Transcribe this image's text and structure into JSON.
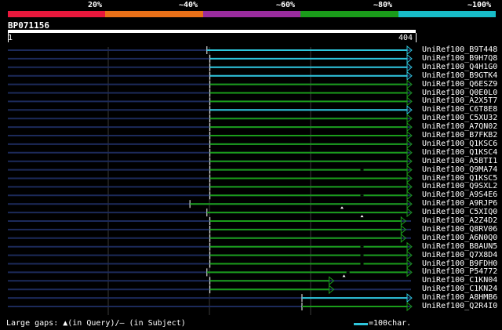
{
  "identity_scale": [
    {
      "label": "20%",
      "color": "#e8183c"
    },
    {
      "label": "~40%",
      "color": "#e87018"
    },
    {
      "label": "~60%",
      "color": "#9a2c9e"
    },
    {
      "label": "~80%",
      "color": "#1a9c1a"
    },
    {
      "label": "~100%",
      "color": "#18bcc8"
    }
  ],
  "query": {
    "name": "BP071156",
    "start": "1",
    "end": "404",
    "length": 404
  },
  "hits": [
    {
      "name": "UniRef100_B9T448",
      "qstart": 200,
      "qend": 404,
      "color": "#2ec6dc",
      "arrow": true
    },
    {
      "name": "UniRef100_B9H7Q8",
      "qstart": 203,
      "qend": 404,
      "color": "#2ec6dc",
      "arrow": true
    },
    {
      "name": "UniRef100_Q4H1G0",
      "qstart": 203,
      "qend": 404,
      "color": "#2ec6dc",
      "arrow": true
    },
    {
      "name": "UniRef100_B9GTK4",
      "qstart": 203,
      "qend": 404,
      "color": "#2ec6dc",
      "arrow": true
    },
    {
      "name": "UniRef100_Q6ESZ9",
      "qstart": 203,
      "qend": 404,
      "color": "#1a9c1a",
      "arrow": true
    },
    {
      "name": "UniRef100_Q0E0L0",
      "qstart": 203,
      "qend": 404,
      "color": "#1a9c1a",
      "arrow": true
    },
    {
      "name": "UniRef100_A2X5T7",
      "qstart": 203,
      "qend": 404,
      "color": "#1a9c1a",
      "arrow": true
    },
    {
      "name": "UniRef100_C6T8E8",
      "qstart": 203,
      "qend": 404,
      "color": "#2ec6dc",
      "arrow": true
    },
    {
      "name": "UniRef100_C5XU32",
      "qstart": 203,
      "qend": 404,
      "color": "#1a9c1a",
      "arrow": true
    },
    {
      "name": "UniRef100_A7QN02",
      "qstart": 203,
      "qend": 404,
      "color": "#1a9c1a",
      "arrow": true
    },
    {
      "name": "UniRef100_B7FKB2",
      "qstart": 203,
      "qend": 404,
      "color": "#1a9c1a",
      "arrow": true
    },
    {
      "name": "UniRef100_Q1KSC6",
      "qstart": 203,
      "qend": 404,
      "color": "#1a9c1a",
      "arrow": true
    },
    {
      "name": "UniRef100_Q1KSC4",
      "qstart": 203,
      "qend": 404,
      "color": "#1a9c1a",
      "arrow": true
    },
    {
      "name": "UniRef100_A5BTI1",
      "qstart": 203,
      "qend": 404,
      "color": "#1a9c1a",
      "arrow": true
    },
    {
      "name": "UniRef100_Q9MA74",
      "qstart": 203,
      "qend": 404,
      "color": "#1a9c1a",
      "arrow": true,
      "gap_subject": 355
    },
    {
      "name": "UniRef100_Q1KSC5",
      "qstart": 203,
      "qend": 404,
      "color": "#1a9c1a",
      "arrow": true
    },
    {
      "name": "UniRef100_Q9SXL2",
      "qstart": 203,
      "qend": 404,
      "color": "#1a9c1a",
      "arrow": true
    },
    {
      "name": "UniRef100_A9S4E6",
      "qstart": 203,
      "qend": 404,
      "color": "#1a9c1a",
      "arrow": true,
      "gap_subject": 355
    },
    {
      "name": "UniRef100_A9RJP6",
      "qstart": 183,
      "qend": 404,
      "color": "#1a9c1a",
      "arrow": true,
      "gap_query": 335
    },
    {
      "name": "UniRef100_C5XIQ0",
      "qstart": 200,
      "qend": 404,
      "color": "#1a9c1a",
      "arrow": true,
      "gap_query": 355
    },
    {
      "name": "UniRef100_A2Z4D2",
      "qstart": 203,
      "qend": 398,
      "color": "#1a9c1a",
      "arrow": true
    },
    {
      "name": "UniRef100_Q8RV06",
      "qstart": 203,
      "qend": 398,
      "color": "#1a9c1a",
      "arrow": true
    },
    {
      "name": "UniRef100_A6N0Q0",
      "qstart": 203,
      "qend": 398,
      "color": "#1a9c1a",
      "arrow": true
    },
    {
      "name": "UniRef100_B8AUN5",
      "qstart": 203,
      "qend": 404,
      "color": "#1a9c1a",
      "arrow": true,
      "gap_subject": 355
    },
    {
      "name": "UniRef100_Q7X8D4",
      "qstart": 203,
      "qend": 404,
      "color": "#1a9c1a",
      "arrow": true,
      "gap_subject": 355
    },
    {
      "name": "UniRef100_B9FDH0",
      "qstart": 203,
      "qend": 404,
      "color": "#1a9c1a",
      "arrow": true,
      "gap_subject": 355
    },
    {
      "name": "UniRef100_P54772",
      "qstart": 200,
      "qend": 404,
      "color": "#1a9c1a",
      "arrow": true,
      "gap_query": 337,
      "gap_subject": 341
    },
    {
      "name": "UniRef100_C1KN04",
      "qstart": 203,
      "qend": 326,
      "color": "#1a9c1a",
      "arrow": true
    },
    {
      "name": "UniRef100_C1KN24",
      "qstart": 203,
      "qend": 326,
      "color": "#1a9c1a",
      "arrow": true
    },
    {
      "name": "UniRef100_A8HMB6",
      "qstart": 295,
      "qend": 404,
      "color": "#2ec6dc",
      "arrow": true
    },
    {
      "name": "UniRef100_Q2R4I0",
      "qstart": 295,
      "qend": 404,
      "color": "#1a9c1a",
      "arrow": true
    }
  ],
  "footer": {
    "gaps_text": "Large gaps: ▲(in Query)/— (in Subject)",
    "scale_text": "=100char."
  }
}
